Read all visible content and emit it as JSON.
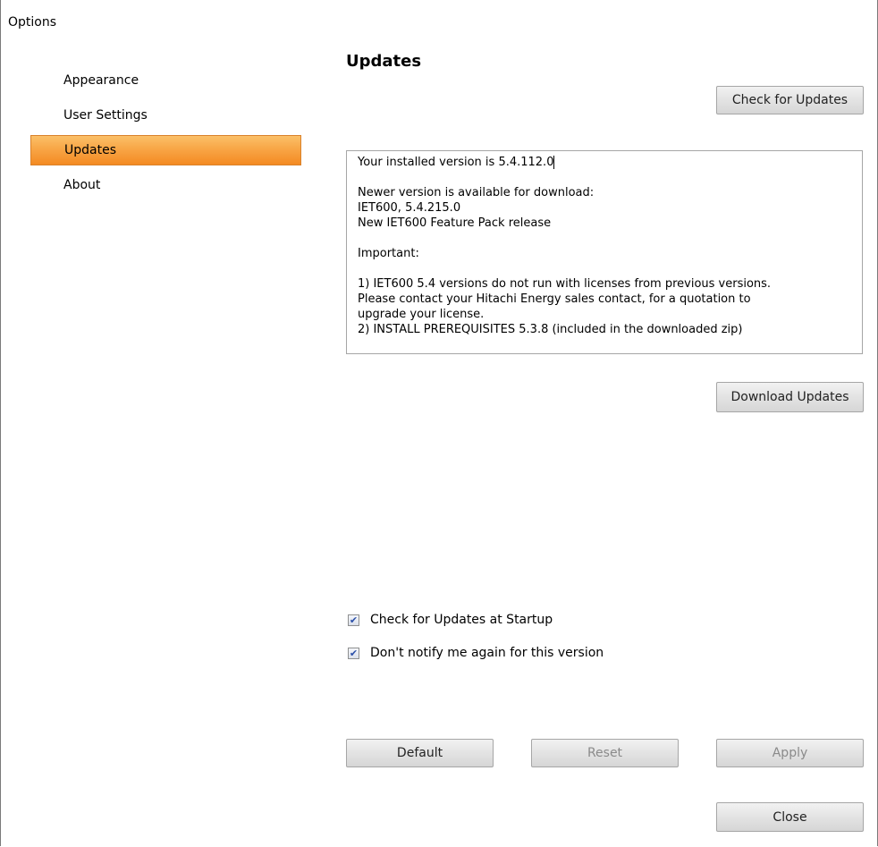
{
  "window": {
    "title": "Options"
  },
  "nav": {
    "items": [
      {
        "label": "Appearance",
        "active": false
      },
      {
        "label": "User Settings",
        "active": false
      },
      {
        "label": "Updates",
        "active": true
      },
      {
        "label": "About",
        "active": false
      }
    ]
  },
  "main": {
    "section_title": "Updates",
    "check_updates_label": "Check for Updates",
    "download_updates_label": "Download Updates",
    "info_lines": [
      "Your installed version is 5.4.112.0",
      "",
      "Newer version is available for download:",
      "IET600, 5.4.215.0",
      "New IET600 Feature Pack release",
      "",
      "Important:",
      "",
      "1) IET600 5.4 versions do not run with licenses from previous versions.",
      "Please contact your Hitachi Energy sales contact, for a quotation to",
      "upgrade your license.",
      "2) INSTALL PREREQUISITES 5.3.8 (included in the downloaded zip)"
    ],
    "checkboxes": [
      {
        "label": "Check for Updates at Startup",
        "checked": true
      },
      {
        "label": "Don't notify me again for this version",
        "checked": true
      }
    ]
  },
  "footer": {
    "default_label": "Default",
    "reset_label": "Reset",
    "apply_label": "Apply",
    "close_label": "Close"
  },
  "colors": {
    "active_nav": "#f8a646",
    "button_bg": "#e3e3e3",
    "disabled_text": "#8a8a8a"
  }
}
